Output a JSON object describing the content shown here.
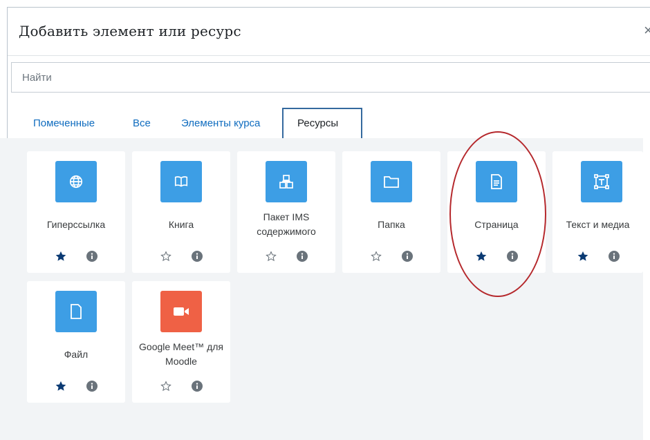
{
  "modal": {
    "title": "Добавить элемент или ресурс",
    "close_label": "×"
  },
  "search": {
    "placeholder": "Найти"
  },
  "tabs": [
    {
      "label": "Помеченные"
    },
    {
      "label": "Все"
    },
    {
      "label": "Элементы курса"
    },
    {
      "label": "Ресурсы",
      "active": true
    }
  ],
  "colors": {
    "icon_bg": "#3d9ee5",
    "icon_bg_orange": "#ef6145",
    "star_filled": "#0b3a73",
    "highlight": "#b5282c"
  },
  "cards": [
    {
      "label": "Гиперссылка",
      "icon": "globe-icon",
      "starred": true
    },
    {
      "label": "Книга",
      "icon": "book-icon",
      "starred": false
    },
    {
      "label": "Пакет IMS содержимого",
      "icon": "package-icon",
      "starred": false
    },
    {
      "label": "Папка",
      "icon": "folder-icon",
      "starred": false
    },
    {
      "label": "Страница",
      "icon": "page-icon",
      "starred": true
    },
    {
      "label": "Текст и медиа",
      "icon": "text-media-icon",
      "starred": true
    },
    {
      "label": "Файл",
      "icon": "file-icon",
      "starred": true
    },
    {
      "label": "Google Meet™ для Moodle",
      "icon": "video-camera-icon",
      "starred": false
    }
  ]
}
